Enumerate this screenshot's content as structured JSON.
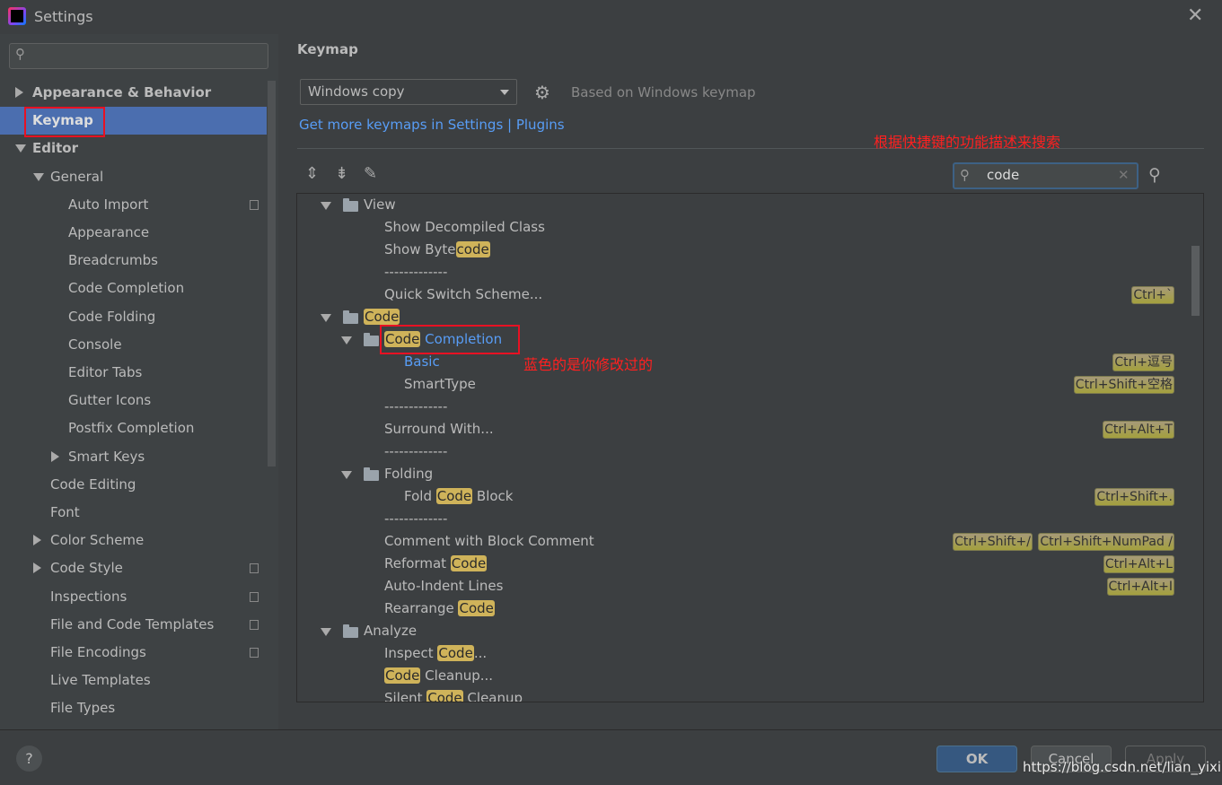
{
  "window": {
    "title": "Settings"
  },
  "sidebar": {
    "search_placeholder": "",
    "items": [
      {
        "label": "Appearance & Behavior",
        "level": 0,
        "arrow": "right",
        "bold": true
      },
      {
        "label": "Keymap",
        "level": 0,
        "selected": true,
        "bold": true
      },
      {
        "label": "Editor",
        "level": 0,
        "arrow": "down",
        "bold": true
      },
      {
        "label": "General",
        "level": 1,
        "arrow": "down"
      },
      {
        "label": "Auto Import",
        "level": 2,
        "copy": true
      },
      {
        "label": "Appearance",
        "level": 2
      },
      {
        "label": "Breadcrumbs",
        "level": 2
      },
      {
        "label": "Code Completion",
        "level": 2
      },
      {
        "label": "Code Folding",
        "level": 2
      },
      {
        "label": "Console",
        "level": 2
      },
      {
        "label": "Editor Tabs",
        "level": 2
      },
      {
        "label": "Gutter Icons",
        "level": 2
      },
      {
        "label": "Postfix Completion",
        "level": 2
      },
      {
        "label": "Smart Keys",
        "level": 2,
        "arrow": "right"
      },
      {
        "label": "Code Editing",
        "level": 1
      },
      {
        "label": "Font",
        "level": 1
      },
      {
        "label": "Color Scheme",
        "level": 1,
        "arrow": "right"
      },
      {
        "label": "Code Style",
        "level": 1,
        "arrow": "right",
        "copy": true
      },
      {
        "label": "Inspections",
        "level": 1,
        "copy": true
      },
      {
        "label": "File and Code Templates",
        "level": 1,
        "copy": true
      },
      {
        "label": "File Encodings",
        "level": 1,
        "copy": true
      },
      {
        "label": "Live Templates",
        "level": 1
      },
      {
        "label": "File Types",
        "level": 1
      }
    ]
  },
  "main": {
    "title": "Keymap",
    "keymap_select": "Windows copy",
    "based_on": "Based on Windows keymap",
    "link": "Get more keymaps in Settings | Plugins",
    "search_value": "code",
    "tree": [
      {
        "indent": 0,
        "folder": true,
        "parts": [
          {
            "t": "View"
          }
        ]
      },
      {
        "indent": 1,
        "parts": [
          {
            "t": "Show Decompiled Class"
          }
        ]
      },
      {
        "indent": 1,
        "parts": [
          {
            "t": "Show Byte"
          },
          {
            "t": "code",
            "hl": true
          }
        ]
      },
      {
        "indent": 1,
        "parts": [
          {
            "t": "-------------"
          }
        ]
      },
      {
        "indent": 1,
        "parts": [
          {
            "t": "Quick Switch Scheme..."
          }
        ],
        "keys": [
          "Ctrl+`"
        ]
      },
      {
        "indent": 0,
        "folder": true,
        "parts": [
          {
            "t": "Code",
            "hl": true
          }
        ]
      },
      {
        "indent": 1,
        "folder": true,
        "parts": [
          {
            "t": "Code",
            "hl": true
          },
          {
            "t": " Completion",
            "blue": true
          }
        ]
      },
      {
        "indent": 2,
        "parts": [
          {
            "t": "Basic",
            "blue": true
          }
        ],
        "keys": [
          "Ctrl+逗号"
        ]
      },
      {
        "indent": 2,
        "parts": [
          {
            "t": "SmartType"
          }
        ],
        "keys": [
          "Ctrl+Shift+空格"
        ]
      },
      {
        "indent": 1,
        "parts": [
          {
            "t": "-------------"
          }
        ]
      },
      {
        "indent": 1,
        "parts": [
          {
            "t": "Surround With..."
          }
        ],
        "keys": [
          "Ctrl+Alt+T"
        ]
      },
      {
        "indent": 1,
        "parts": [
          {
            "t": "-------------"
          }
        ]
      },
      {
        "indent": 1,
        "folder": true,
        "parts": [
          {
            "t": "Folding"
          }
        ]
      },
      {
        "indent": 2,
        "parts": [
          {
            "t": "Fold "
          },
          {
            "t": "Code",
            "hl": true
          },
          {
            "t": " Block"
          }
        ],
        "keys": [
          "Ctrl+Shift+."
        ]
      },
      {
        "indent": 1,
        "parts": [
          {
            "t": "-------------"
          }
        ]
      },
      {
        "indent": 1,
        "parts": [
          {
            "t": "Comment with Block Comment"
          }
        ],
        "keys": [
          "Ctrl+Shift+/",
          "Ctrl+Shift+NumPad /"
        ]
      },
      {
        "indent": 1,
        "parts": [
          {
            "t": "Reformat "
          },
          {
            "t": "Code",
            "hl": true
          }
        ],
        "keys": [
          "Ctrl+Alt+L"
        ]
      },
      {
        "indent": 1,
        "parts": [
          {
            "t": "Auto-Indent Lines"
          }
        ],
        "keys": [
          "Ctrl+Alt+I"
        ]
      },
      {
        "indent": 1,
        "parts": [
          {
            "t": "Rearrange "
          },
          {
            "t": "Code",
            "hl": true
          }
        ]
      },
      {
        "indent": 0,
        "folder": true,
        "parts": [
          {
            "t": "Analyze"
          }
        ]
      },
      {
        "indent": 1,
        "parts": [
          {
            "t": "Inspect "
          },
          {
            "t": "Code",
            "hl": true
          },
          {
            "t": "..."
          }
        ]
      },
      {
        "indent": 1,
        "parts": [
          {
            "t": "Code",
            "hl": true
          },
          {
            "t": " Cleanup..."
          }
        ]
      },
      {
        "indent": 1,
        "parts": [
          {
            "t": "Silent "
          },
          {
            "t": "Code",
            "hl": true
          },
          {
            "t": " Cleanup"
          }
        ]
      }
    ]
  },
  "annotations": {
    "search_hint": "根据快捷键的功能描述来搜索",
    "blue_hint": "蓝色的是你修改过的"
  },
  "footer": {
    "help": "?",
    "ok": "OK",
    "cancel": "Cancel",
    "apply": "Apply",
    "watermark": "https://blog.csdn.net/lian_yixin"
  },
  "colors": {
    "accent": "#4b6eaf",
    "link": "#589df6",
    "highlight": "#cfb35a",
    "annotation": "#ff2020"
  }
}
